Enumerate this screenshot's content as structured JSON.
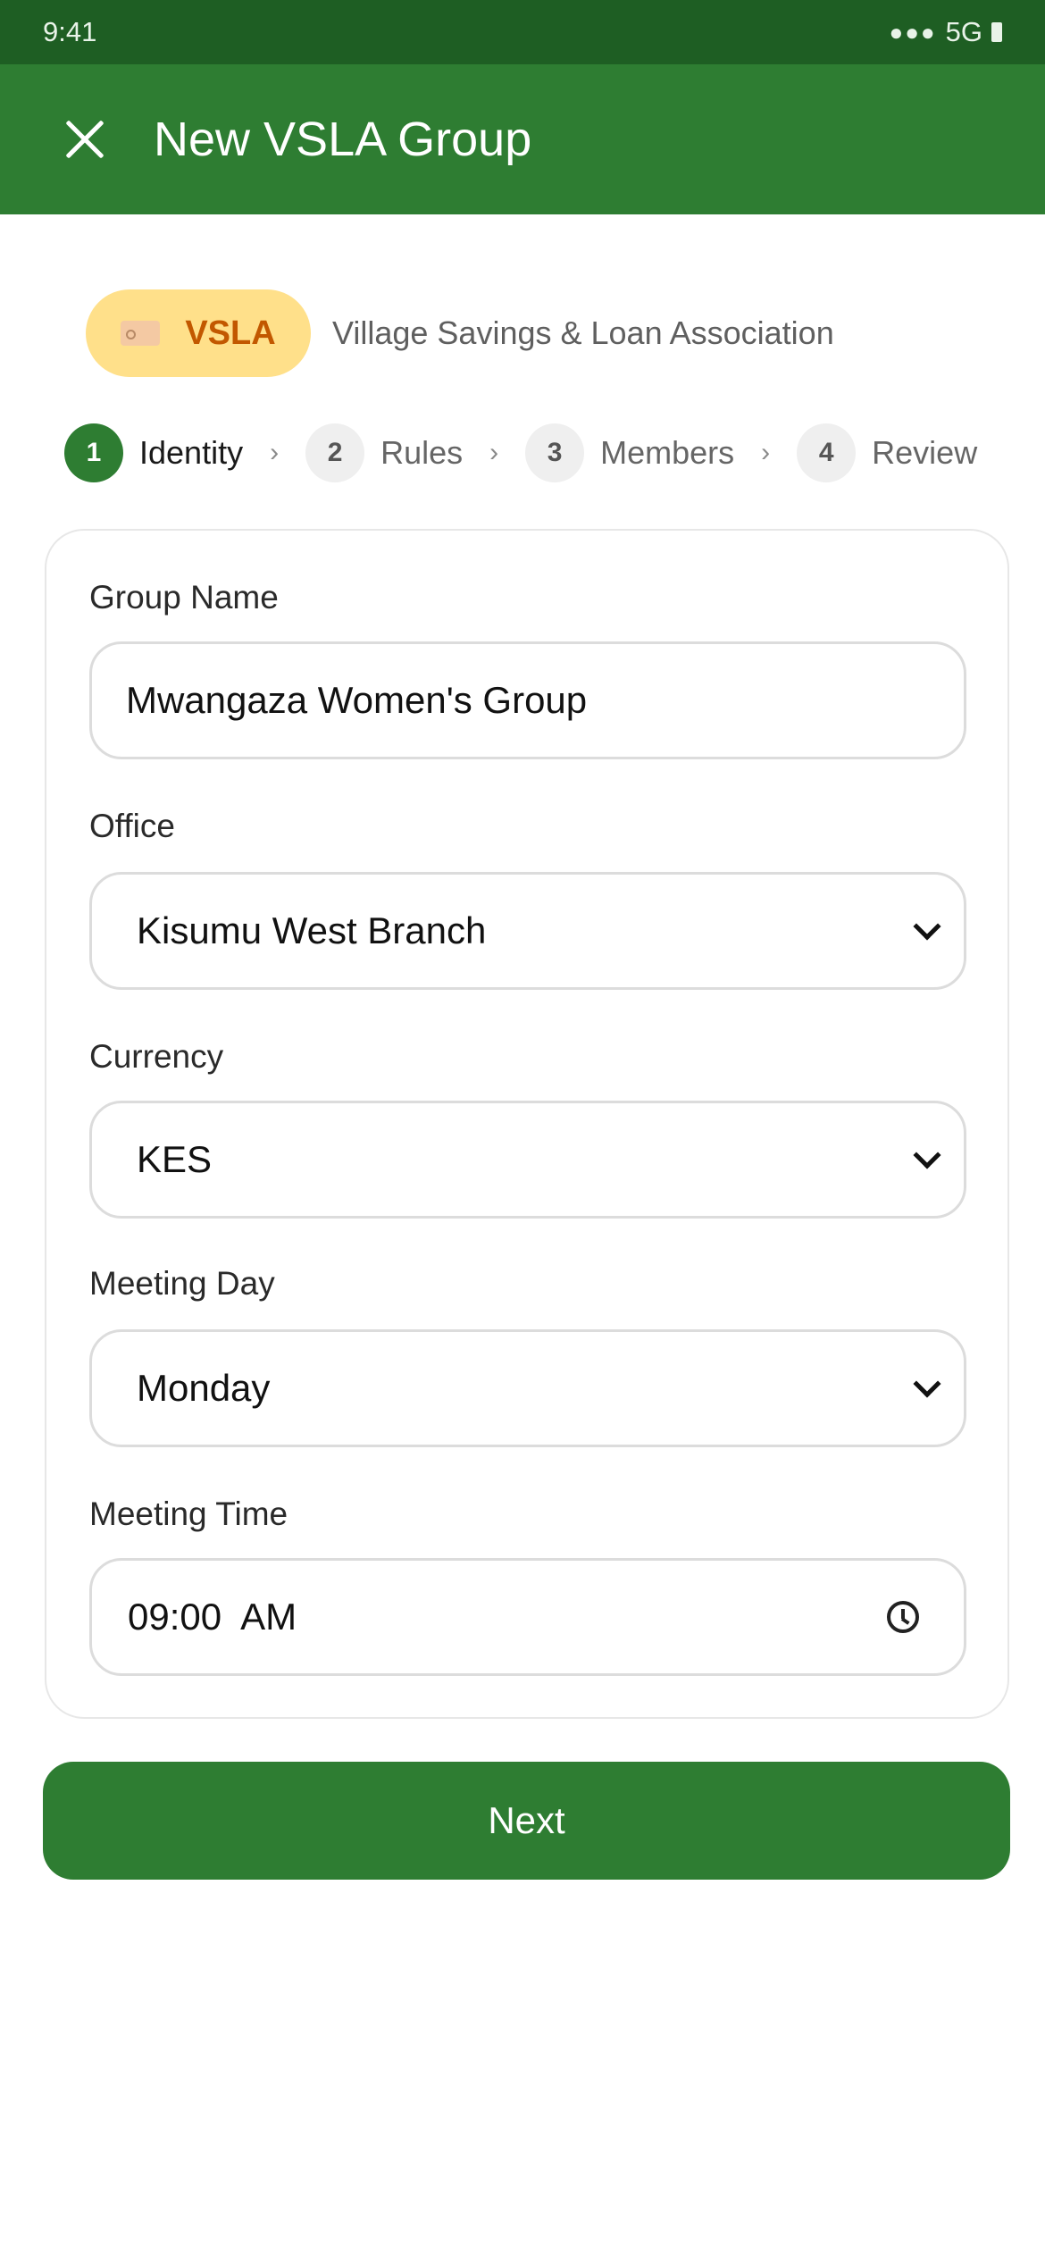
{
  "status_bar": {
    "time": "9:41",
    "signal": "●●●",
    "network": "5G"
  },
  "app_bar": {
    "title": "New VSLA Group",
    "close_icon": "close-icon"
  },
  "group_type": {
    "badge_label": "VSLA",
    "badge_icon": "tag-icon",
    "description": "Village Savings & Loan Association",
    "badge_color": "#ffe08a",
    "badge_text_color": "#c25800"
  },
  "stepper": {
    "active_step": 1,
    "steps": [
      {
        "number": "1",
        "label": "Identity"
      },
      {
        "number": "2",
        "label": "Rules"
      },
      {
        "number": "3",
        "label": "Members"
      },
      {
        "number": "4",
        "label": "Review"
      }
    ],
    "separator": "›"
  },
  "form": {
    "group_name": {
      "label": "Group Name",
      "value": "Mwangaza Women's Group"
    },
    "office": {
      "label": "Office",
      "value": "Kisumu West Branch"
    },
    "currency": {
      "label": "Currency",
      "value": "KES"
    },
    "meeting_day": {
      "label": "Meeting Day",
      "value": "Monday"
    },
    "meeting_time": {
      "label": "Meeting Time",
      "value": "09:00  AM"
    }
  },
  "actions": {
    "next_label": "Next"
  },
  "colors": {
    "primary": "#2e7d32",
    "status_bar": "#1e5e23"
  }
}
